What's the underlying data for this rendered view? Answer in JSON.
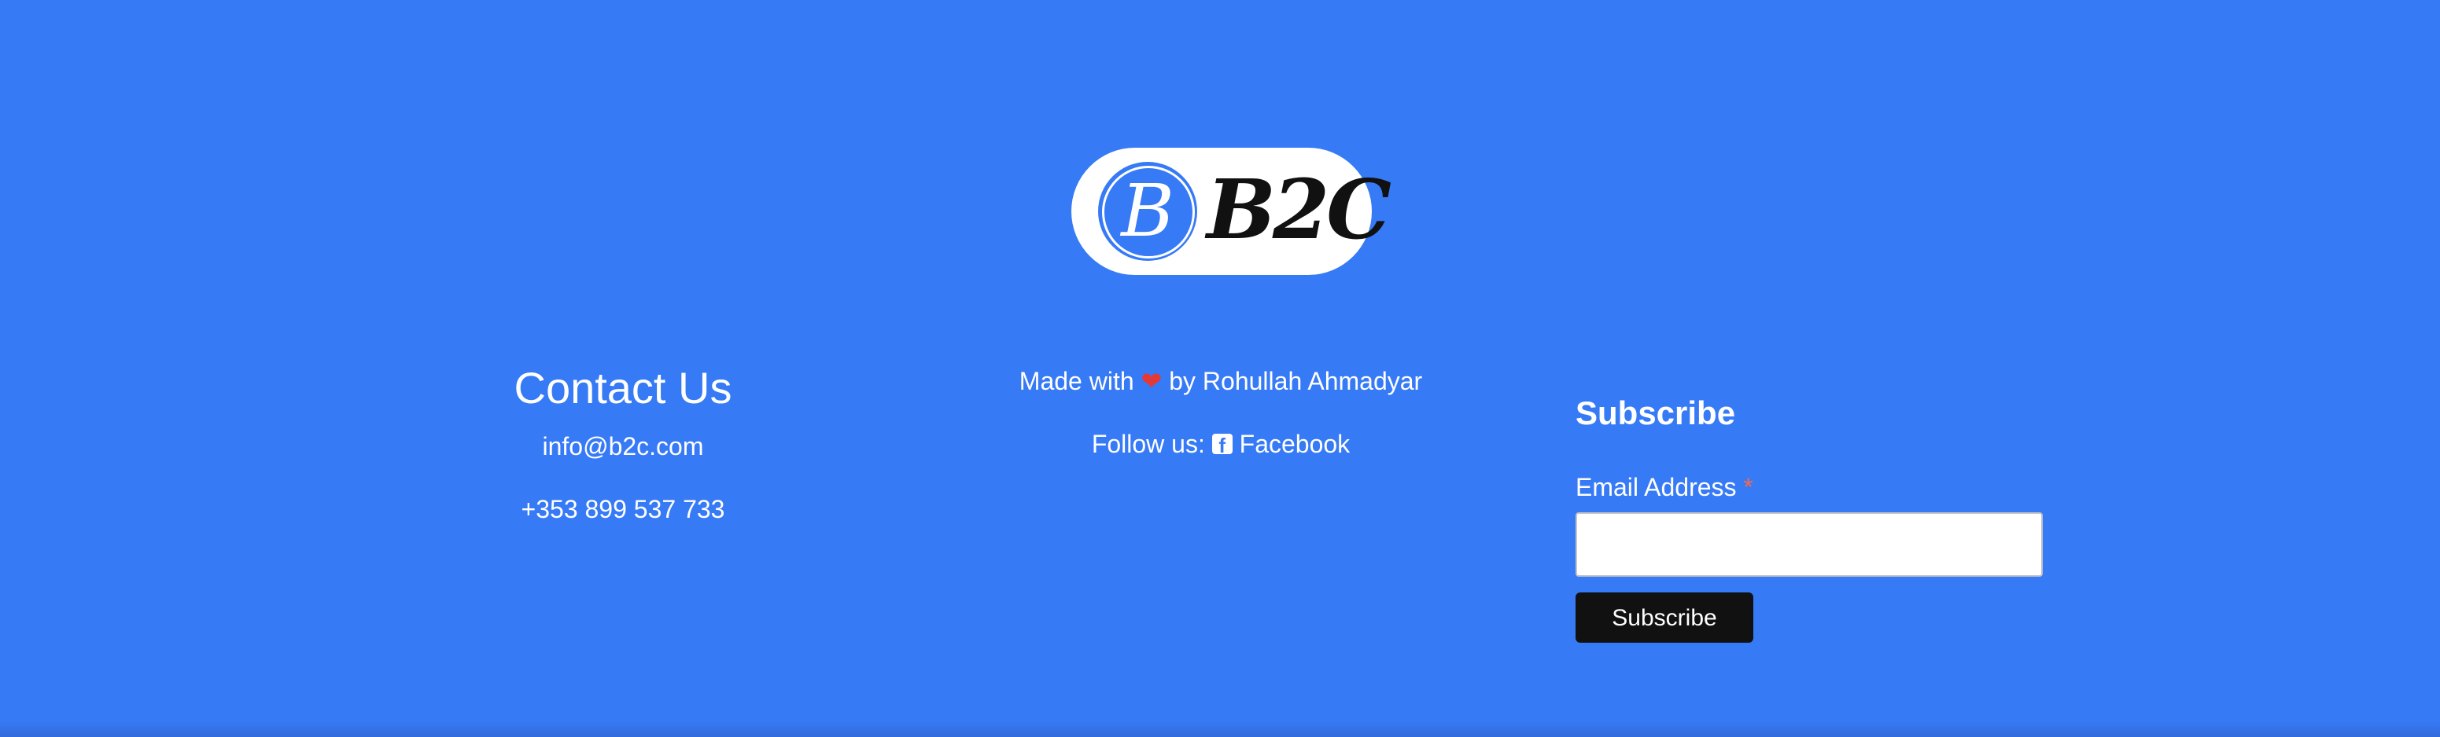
{
  "brand": {
    "logo_letter": "B",
    "logo_text": "B2C",
    "primary_color": "#377af6"
  },
  "contact": {
    "title": "Contact Us",
    "email": "info@b2c.com",
    "phone": "+353 899 537 733"
  },
  "credits": {
    "made_with_prefix": "Made with",
    "heart": "❤",
    "made_with_suffix": "by Rohullah Ahmadyar",
    "follow_prefix": "Follow us:",
    "facebook_icon": "facebook-square-icon",
    "facebook_label": "Facebook"
  },
  "subscribe": {
    "title": "Subscribe",
    "email_label": "Email Address",
    "required_marker": "*",
    "email_value": "",
    "button_label": "Subscribe"
  }
}
